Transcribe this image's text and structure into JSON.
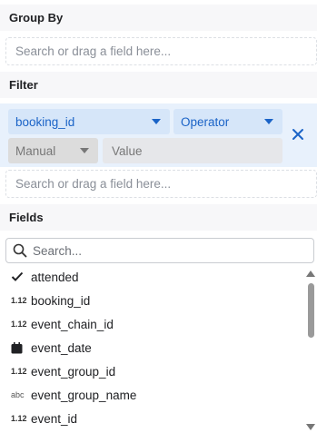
{
  "group_by": {
    "title": "Group By",
    "dropzone_placeholder": "Search or drag a field here..."
  },
  "filter": {
    "title": "Filter",
    "field_select": "booking_id",
    "operator_select": "Operator",
    "mode_select": "Manual",
    "value_placeholder": "Value",
    "dropzone_placeholder": "Search or drag a field here..."
  },
  "fields": {
    "title": "Fields",
    "search_placeholder": "Search...",
    "items": [
      {
        "label": "attended",
        "type_icon": "check-icon",
        "type_text": ""
      },
      {
        "label": "booking_id",
        "type_icon": "number-type-icon",
        "type_text": "1.12"
      },
      {
        "label": "event_chain_id",
        "type_icon": "number-type-icon",
        "type_text": "1.12"
      },
      {
        "label": "event_date",
        "type_icon": "calendar-icon",
        "type_text": ""
      },
      {
        "label": "event_group_id",
        "type_icon": "number-type-icon",
        "type_text": "1.12"
      },
      {
        "label": "event_group_name",
        "type_icon": "text-type-icon",
        "type_text": "abc"
      },
      {
        "label": "event_id",
        "type_icon": "number-type-icon",
        "type_text": "1.12"
      }
    ]
  },
  "colors": {
    "accent": "#1a63c7",
    "filter_bg": "#e8f1fc",
    "header_bg": "#f7f7f9"
  }
}
